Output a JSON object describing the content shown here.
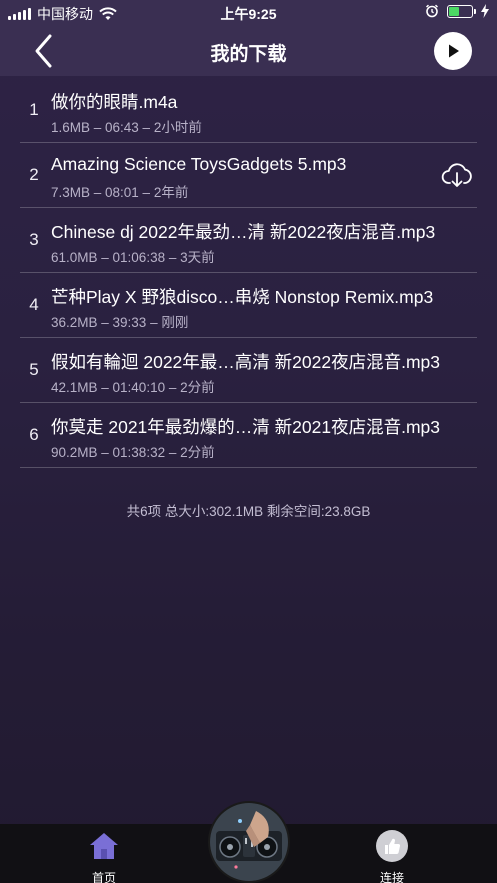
{
  "status_bar": {
    "carrier": "中国移动",
    "time": "上午9:25",
    "battery_level": 0.45
  },
  "nav": {
    "title": "我的下载"
  },
  "downloads": [
    {
      "index": "1",
      "title": "做你的眼睛.m4a",
      "meta": "1.6MB – 06:43 – 2小时前",
      "cloud": false
    },
    {
      "index": "2",
      "title": "Amazing Science ToysGadgets 5.mp3",
      "meta": "7.3MB – 08:01 – 2年前",
      "cloud": true
    },
    {
      "index": "3",
      "title": "Chinese dj  2022年最劲…清 新2022夜店混音.mp3",
      "meta": "61.0MB – 01:06:38 – 3天前",
      "cloud": false
    },
    {
      "index": "4",
      "title": "芒种Play X 野狼disco…串烧 Nonstop Remix.mp3",
      "meta": "36.2MB – 39:33 – 刚刚",
      "cloud": false
    },
    {
      "index": "5",
      "title": "假如有輪迴   2022年最…高清 新2022夜店混音.mp3",
      "meta": "42.1MB – 01:40:10 – 2分前",
      "cloud": false
    },
    {
      "index": "6",
      "title": "你莫走   2021年最劲爆的…清 新2021夜店混音.mp3",
      "meta": "90.2MB – 01:38:32 – 2分前",
      "cloud": false
    }
  ],
  "summary": "共6项 总大小:302.1MB 剩余空间:23.8GB",
  "tabbar": {
    "home_label": "首页",
    "connect_label": "连接"
  },
  "colors": {
    "background": "#2a2140",
    "header": "#3a2f52",
    "home_icon": "#7a6fd6",
    "tabbar": "#111014"
  },
  "icons": {
    "back": "chevron-left-icon",
    "play": "play-icon",
    "cloud": "cloud-download-icon",
    "home": "home-icon",
    "connect": "thumbs-up-icon"
  }
}
